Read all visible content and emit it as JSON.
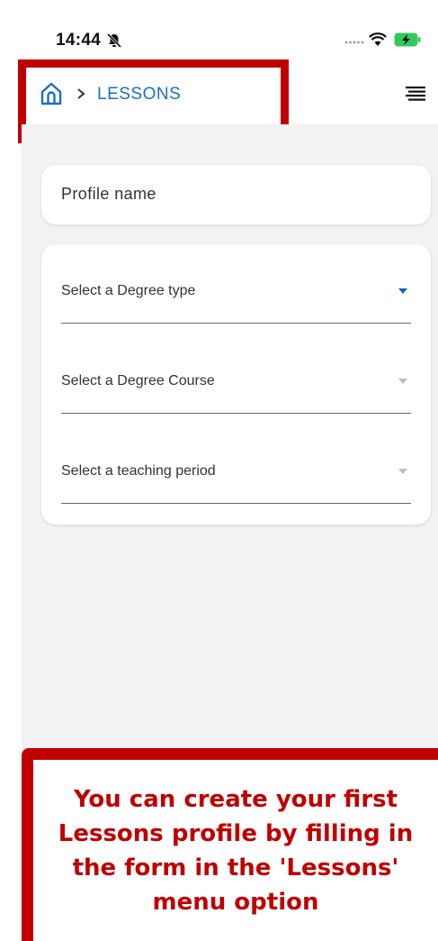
{
  "status_bar": {
    "time": "14:44"
  },
  "header": {
    "breadcrumb_label": "LESSONS"
  },
  "form": {
    "profile_placeholder": "Profile name",
    "degree_type_label": "Select a Degree type",
    "degree_course_label": "Select a Degree Course",
    "teaching_period_label": "Select a teaching period"
  },
  "callout": {
    "text": "You can create your first Lessons profile by filling in the form in the 'Lessons' menu option"
  },
  "colors": {
    "accent": "#1d6fc2",
    "highlight": "#c00000",
    "background": "#f2f2f2"
  }
}
